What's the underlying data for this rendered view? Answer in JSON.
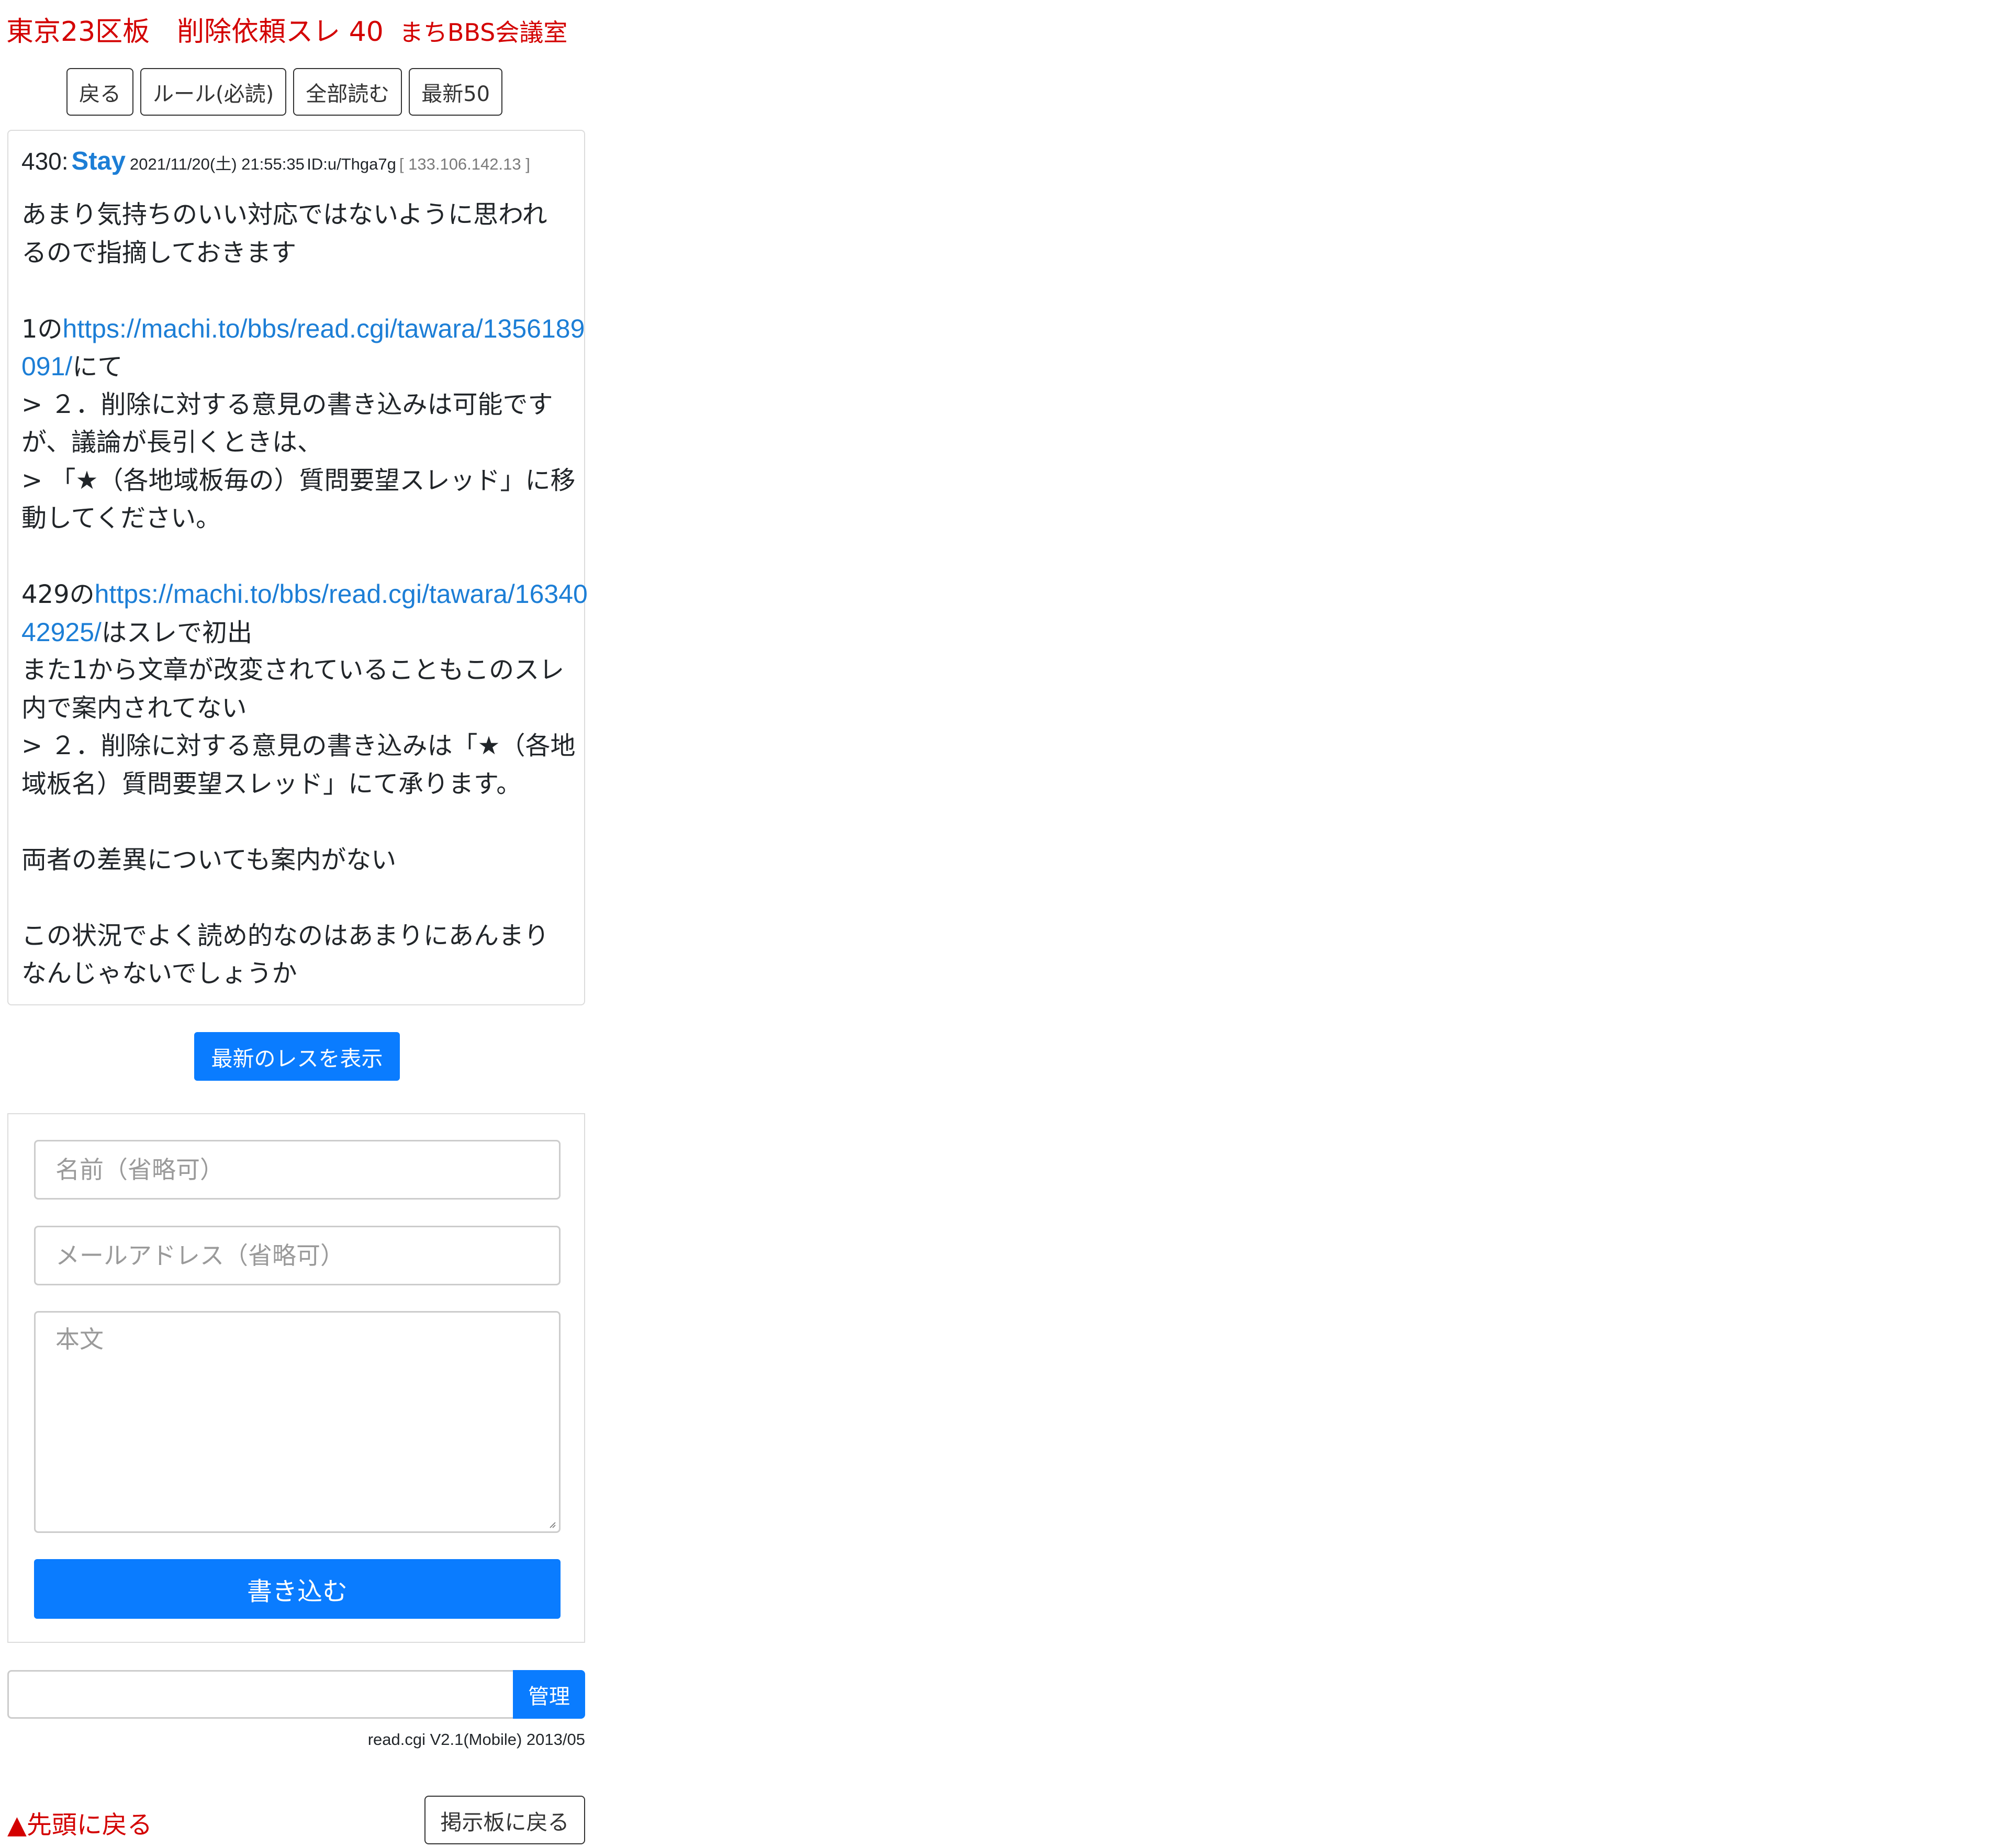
{
  "header": {
    "title": "東京23区板　削除依頼スレ 40",
    "site": "まちBBS会議室"
  },
  "nav": {
    "back": "戻る",
    "rules": "ルール(必読)",
    "read_all": "全部読む",
    "latest50": "最新50"
  },
  "post": {
    "number": "430:",
    "name": "Stay",
    "datetime": "2021/11/20(土) 21:55:35",
    "id": "ID:u/Thga7g",
    "ip": "[ 133.106.142.13 ]",
    "lines": {
      "l1": "あまり気持ちのいい対応ではないように思われ",
      "l2": "るので指摘しておきます",
      "l4_pre": "1の",
      "l4_link": "https://machi.to/bbs/read.cgi/tawara/1356189",
      "l5_link": "091/",
      "l5_post": "にて",
      "l6": "> ２．削除に対する意見の書き込みは可能です",
      "l7": "が、議論が長引くときは、",
      "l8": "> 「★（各地域板毎の）質問要望スレッド」に移",
      "l9": "動してください。",
      "l11_pre": "429の",
      "l11_link": "https://machi.to/bbs/read.cgi/tawara/16340",
      "l12_link": "42925/",
      "l12_post": "はスレで初出",
      "l13": "また1から文章が改変されていることもこのスレ",
      "l14": "内で案内されてない",
      "l15": "> ２．削除に対する意見の書き込みは「★（各地",
      "l16": "域板名）質問要望スレッド」にて承ります。",
      "l18": "両者の差異についても案内がない",
      "l20": "この状況でよく読め的なのはあまりにあんまり",
      "l21": "なんじゃないでしょうか"
    }
  },
  "latest_button": "最新のレスを表示",
  "form": {
    "name_placeholder": "名前（省略可）",
    "mail_placeholder": "メールアドレス（省略可）",
    "body_placeholder": "本文",
    "submit": "書き込む"
  },
  "admin": {
    "button": "管理",
    "input_value": ""
  },
  "footer": {
    "version": "read.cgi V2.1(Mobile) 2013/05",
    "to_top": "▲先頭に戻る",
    "back_to_board": "掲示板に戻る"
  },
  "colors": {
    "title_red": "#d30000",
    "link_blue": "#1c7ed6",
    "button_blue": "#0a7cff"
  }
}
